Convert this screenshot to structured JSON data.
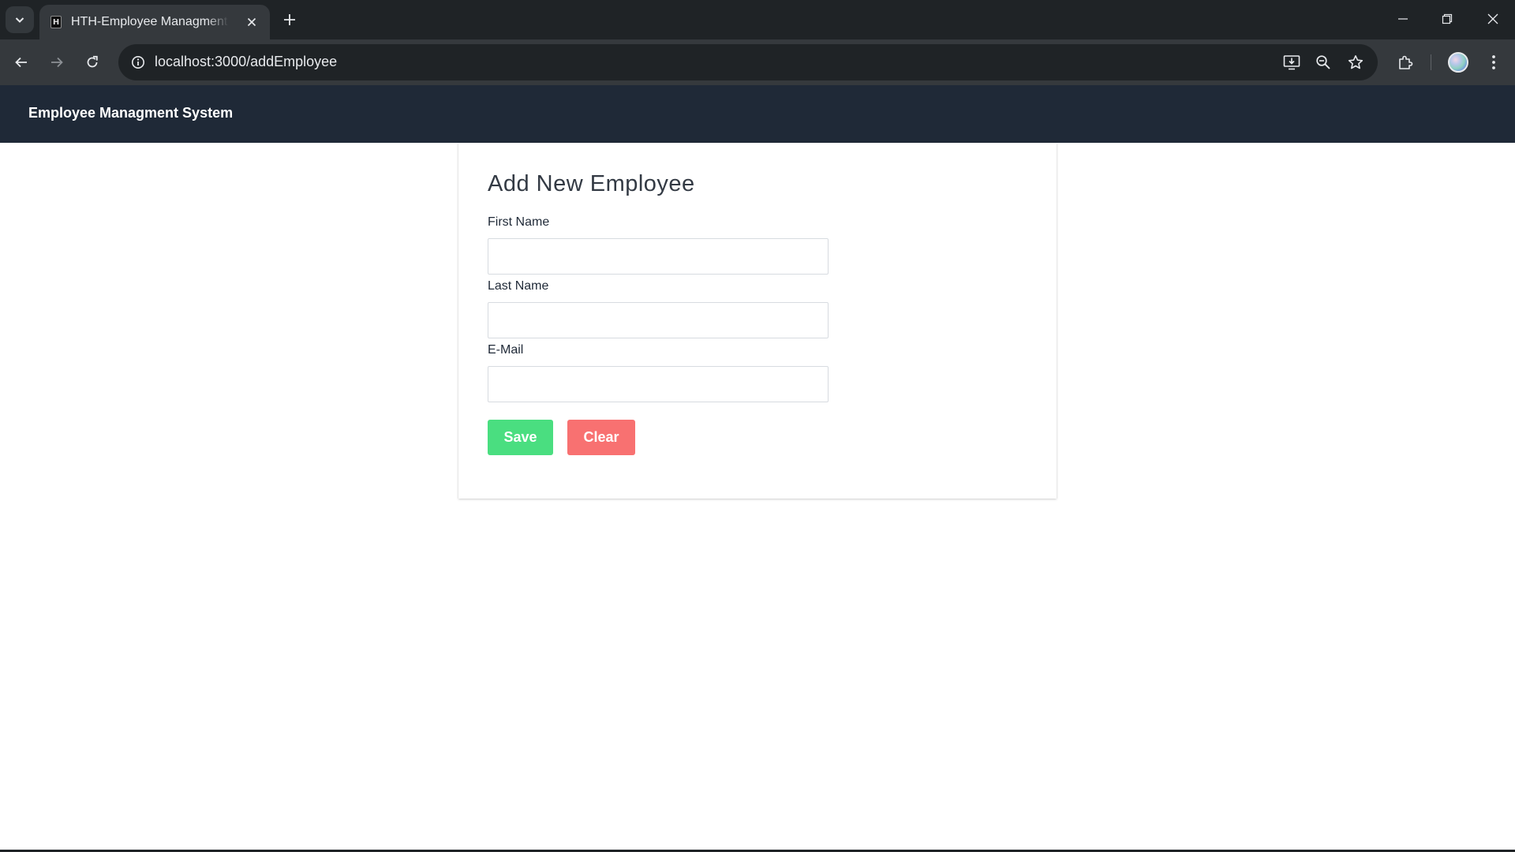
{
  "browser": {
    "tab": {
      "title": "HTH-Employee Managment System",
      "favicon_letter": "H"
    },
    "address_bar": {
      "url": "localhost:3000/addEmployee"
    },
    "icons": {
      "tab_search": "chevron-down-icon",
      "tab_close": "close-icon",
      "new_tab": "plus-icon",
      "back": "arrow-left-icon",
      "forward": "arrow-right-icon",
      "reload": "reload-icon",
      "site_info": "info-icon",
      "install": "install-app-icon",
      "zoom": "zoom-out-icon",
      "bookmark": "star-icon",
      "extensions": "puzzle-icon",
      "menu": "kebab-menu-icon"
    }
  },
  "app": {
    "brand": "Employee Managment System"
  },
  "form": {
    "title": "Add New Employee",
    "fields": {
      "first_name": {
        "label": "First Name",
        "value": ""
      },
      "last_name": {
        "label": "Last Name",
        "value": ""
      },
      "email": {
        "label": "E-Mail",
        "value": ""
      }
    },
    "buttons": {
      "save": "Save",
      "clear": "Clear"
    }
  },
  "colors": {
    "navbar": "#1f2937",
    "save_button": "#4ade80",
    "clear_button": "#f87171"
  }
}
